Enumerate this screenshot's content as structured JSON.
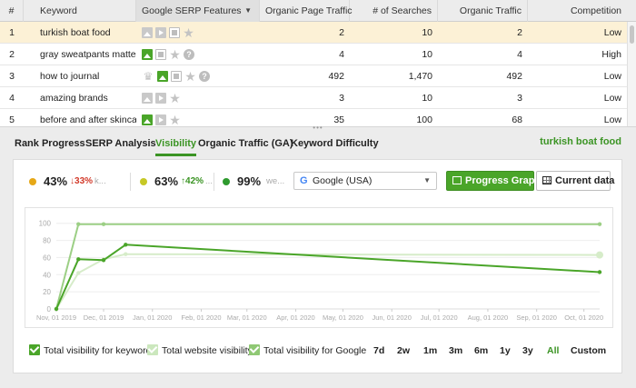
{
  "table": {
    "columns": {
      "index": "#",
      "keyword": "Keyword",
      "features": "Google SERP Features",
      "organic_page_traffic": "Organic Page Traffic",
      "searches": "# of Searches",
      "organic_traffic": "Organic Traffic",
      "competition": "Competition"
    },
    "rows": [
      {
        "index": "1",
        "keyword": "turkish boat food",
        "features": [
          "image",
          "video",
          "snippet",
          "star"
        ],
        "organic_page_traffic": "2",
        "searches": "10",
        "organic_traffic": "2",
        "competition": "Low",
        "selected": true
      },
      {
        "index": "2",
        "keyword": "gray sweatpants matter",
        "features": [
          "image-active",
          "snippet",
          "star",
          "question"
        ],
        "organic_page_traffic": "4",
        "searches": "10",
        "organic_traffic": "4",
        "competition": "High"
      },
      {
        "index": "3",
        "keyword": "how to journal",
        "features": [
          "crown",
          "image-active",
          "snippet",
          "star",
          "question"
        ],
        "organic_page_traffic": "492",
        "searches": "1,470",
        "organic_traffic": "492",
        "competition": "Low"
      },
      {
        "index": "4",
        "keyword": "amazing brands",
        "features": [
          "image",
          "video",
          "star"
        ],
        "organic_page_traffic": "3",
        "searches": "10",
        "organic_traffic": "3",
        "competition": "Low"
      },
      {
        "index": "5",
        "keyword": "before and after skincare",
        "features": [
          "image-active",
          "video",
          "star"
        ],
        "organic_page_traffic": "35",
        "searches": "100",
        "organic_traffic": "68",
        "competition": "Low"
      }
    ]
  },
  "tabs": [
    "Rank Progress",
    "SERP Analysis",
    "Visibility",
    "Organic Traffic (GA)",
    "Keyword Difficulty"
  ],
  "active_tab": "Visibility",
  "selected_keyword": "turkish boat food",
  "stats": [
    {
      "value": "43%",
      "change": "33%",
      "direction": "down",
      "label": "k...",
      "color": "#e6a817"
    },
    {
      "value": "63%",
      "change": "42%",
      "direction": "up",
      "label": "...",
      "color": "#c6c826"
    },
    {
      "value": "99%",
      "change": "",
      "direction": "",
      "label": "we...",
      "color": "#2e9a2e"
    }
  ],
  "search_engine": {
    "logo": "G",
    "value": "Google (USA)"
  },
  "buttons": {
    "progress_graph": "Progress Graph",
    "current_data": "Current data"
  },
  "colors": {
    "accent": "#4aa529",
    "selected_row": "#fcf1d6",
    "down": "#d23a2a"
  },
  "chart_data": {
    "type": "line",
    "x_ticks": [
      "Nov, 01 2019",
      "Dec, 01 2019",
      "Jan, 01 2020",
      "Feb, 01 2020",
      "Mar, 01 2020",
      "Apr, 01 2020",
      "May, 01 2020",
      "Jun, 01 2020",
      "Jul, 01 2020",
      "Aug, 01 2020",
      "Sep, 01 2020",
      "Oct, 01 2020"
    ],
    "y_ticks": [
      0,
      20,
      40,
      60,
      80,
      100
    ],
    "ylim": [
      0,
      105
    ],
    "xlim": [
      "2019-11-01",
      "2020-10-11"
    ],
    "series": [
      {
        "name": "Total visibility for keyword",
        "color": "#4aa529",
        "points": [
          [
            "2019-11-01",
            0
          ],
          [
            "2019-11-15",
            58
          ],
          [
            "2019-12-01",
            57
          ],
          [
            "2019-12-15",
            75
          ],
          [
            "2020-10-11",
            43
          ]
        ]
      },
      {
        "name": "Total website visibility",
        "color": "#d6ecc9",
        "points": [
          [
            "2019-11-01",
            0
          ],
          [
            "2019-11-15",
            42
          ],
          [
            "2019-12-01",
            58
          ],
          [
            "2019-12-15",
            64
          ],
          [
            "2020-10-11",
            63
          ]
        ]
      },
      {
        "name": "Total visibility for Google",
        "color": "#9ccf85",
        "points": [
          [
            "2019-11-01",
            0
          ],
          [
            "2019-11-15",
            99
          ],
          [
            "2019-12-01",
            99
          ],
          [
            "2020-10-11",
            99
          ]
        ]
      }
    ]
  },
  "legend": [
    "Total visibility for keyword",
    "Total website visibility",
    "Total visibility for Google"
  ],
  "ranges": [
    "7d",
    "2w",
    "1m",
    "3m",
    "6m",
    "1y",
    "3y",
    "All",
    "Custom"
  ],
  "active_range": "All"
}
